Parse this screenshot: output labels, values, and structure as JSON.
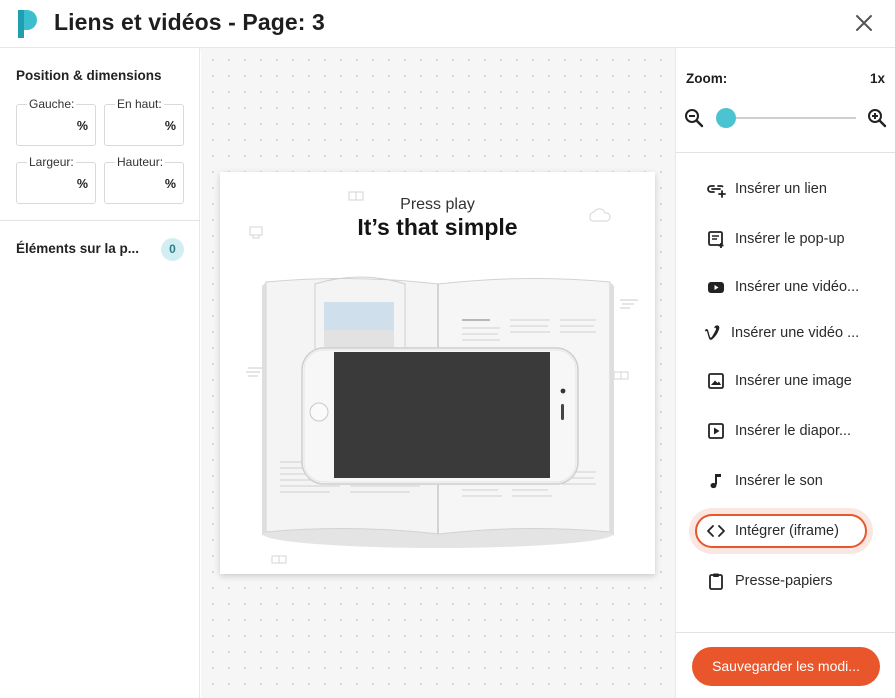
{
  "header": {
    "title": "Liens et vidéos - Page: 3",
    "close_icon": "close-icon",
    "logo_color": "#3bbfcf"
  },
  "left_panel": {
    "section_title": "Position & dimensions",
    "fields": [
      {
        "label": "Gauche:",
        "unit": "%",
        "value": ""
      },
      {
        "label": "En haut:",
        "unit": "%",
        "value": ""
      },
      {
        "label": "Largeur:",
        "unit": "%",
        "value": ""
      },
      {
        "label": "Hauteur:",
        "unit": "%",
        "value": ""
      }
    ],
    "elements_label": "Éléments sur la p...",
    "elements_count": "0"
  },
  "canvas": {
    "page_subtitle": "Press play",
    "page_title": "It’s that simple"
  },
  "right_panel": {
    "zoom_label": "Zoom:",
    "zoom_value": "1x",
    "zoom_level": 0,
    "menu": [
      {
        "label": "Insérer un lien",
        "icon": "link-add-icon"
      },
      {
        "label": "Insérer le pop-up",
        "icon": "popup-icon"
      },
      {
        "label": "Insérer une vidéo...",
        "icon": "youtube-icon"
      },
      {
        "label": "Insérer une vidéo ...",
        "icon": "vimeo-icon"
      },
      {
        "label": "Insérer une image",
        "icon": "image-icon"
      },
      {
        "label": "Insérer le diapor...",
        "icon": "slideshow-icon"
      },
      {
        "label": "Insérer le son",
        "icon": "music-note-icon"
      },
      {
        "label": "Intégrer (iframe)",
        "icon": "code-icon",
        "active": true
      },
      {
        "label": "Presse-papiers",
        "icon": "clipboard-icon"
      }
    ],
    "save_button": "Sauvegarder les modi..."
  },
  "colors": {
    "accent": "#e9562b",
    "accent_light": "#fbe7e2",
    "slider": "#4cc3d0",
    "badge_bg": "#d2eef3"
  }
}
